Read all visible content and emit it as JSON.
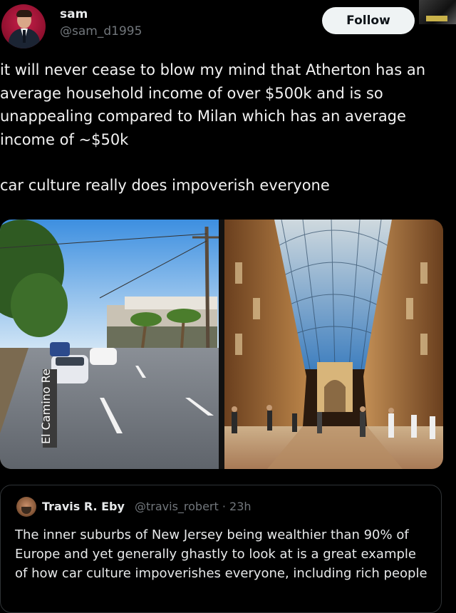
{
  "author": {
    "display_name": "sam",
    "handle": "@sam_d1995",
    "follow_label": "Follow"
  },
  "tweet": {
    "line1": "it will never cease to blow my mind that Atherton has an average household income of over $500k and is so unappealing compared to Milan which has an average income of ~$50k",
    "line2": "car culture really does impoverish everyone"
  },
  "media": {
    "left_image": {
      "street_sign": "El Camino Re"
    },
    "right_image": {}
  },
  "quoted_tweet": {
    "name": "Travis R. Eby",
    "handle": "@travis_robert",
    "time": "23h",
    "meta": "@travis_robert · 23h",
    "text": "The inner suburbs of New Jersey being wealthier than 90% of Europe and yet generally ghastly to look at is a great example of how car culture impoverishes everyone, including rich people"
  },
  "colors": {
    "background": "#000000",
    "text": "#e7e9ea",
    "muted": "#71767b",
    "follow_bg": "#eff3f4"
  }
}
